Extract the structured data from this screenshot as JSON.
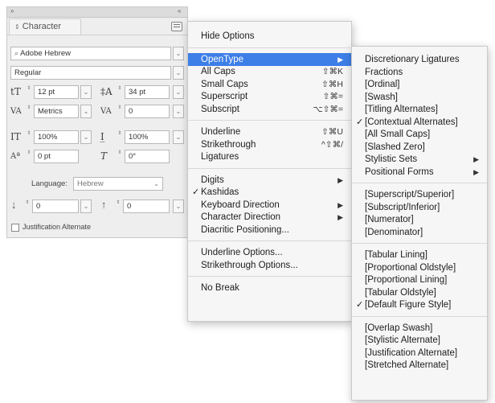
{
  "panel": {
    "topbar_left": "»",
    "topbar_right": "«",
    "title": "Character",
    "font_family": "Adobe Hebrew",
    "font_style": "Regular",
    "font_size": "12 pt",
    "leading": "34 pt",
    "kerning": "Metrics",
    "tracking": "0",
    "vertical_scale": "100%",
    "horizontal_scale": "100%",
    "baseline_shift": "0 pt",
    "skew": "0°",
    "language_label": "Language:",
    "language_value": "Hebrew",
    "space_before": "0",
    "space_after": "0",
    "justification_label": "Justification Alternate"
  },
  "menu_main": [
    {
      "label": "Hide Options"
    },
    {
      "sep": true
    },
    {
      "label": "OpenType",
      "submenu": true,
      "highlighted": true
    },
    {
      "label": "All Caps",
      "shortcut": "⇧⌘K"
    },
    {
      "label": "Small Caps",
      "shortcut": "⇧⌘H"
    },
    {
      "label": "Superscript",
      "shortcut": "⇧⌘="
    },
    {
      "label": "Subscript",
      "shortcut": "⌥⇧⌘="
    },
    {
      "sep": true
    },
    {
      "label": "Underline",
      "shortcut": "⇧⌘U"
    },
    {
      "label": "Strikethrough",
      "shortcut": "^⇧⌘/"
    },
    {
      "label": "Ligatures"
    },
    {
      "sep": true
    },
    {
      "label": "Digits",
      "submenu": true
    },
    {
      "label": "Kashidas",
      "checked": true
    },
    {
      "label": "Keyboard Direction",
      "submenu": true
    },
    {
      "label": "Character Direction",
      "submenu": true
    },
    {
      "label": "Diacritic Positioning..."
    },
    {
      "sep": true
    },
    {
      "label": "Underline Options..."
    },
    {
      "label": "Strikethrough Options..."
    },
    {
      "sep": true
    },
    {
      "label": "No Break"
    }
  ],
  "menu_opentype": [
    {
      "label": "Discretionary Ligatures"
    },
    {
      "label": "Fractions"
    },
    {
      "label": "[Ordinal]"
    },
    {
      "label": "[Swash]"
    },
    {
      "label": "[Titling Alternates]"
    },
    {
      "label": "[Contextual Alternates]",
      "checked": true
    },
    {
      "label": "[All Small Caps]"
    },
    {
      "label": "[Slashed Zero]"
    },
    {
      "label": "Stylistic Sets",
      "submenu": true
    },
    {
      "label": "Positional Forms",
      "submenu": true
    },
    {
      "sep": true
    },
    {
      "label": "[Superscript/Superior]"
    },
    {
      "label": "[Subscript/Inferior]"
    },
    {
      "label": "[Numerator]"
    },
    {
      "label": "[Denominator]"
    },
    {
      "sep": true
    },
    {
      "label": "[Tabular Lining]"
    },
    {
      "label": "[Proportional Oldstyle]"
    },
    {
      "label": "[Proportional Lining]"
    },
    {
      "label": "[Tabular Oldstyle]"
    },
    {
      "label": "[Default Figure Style]",
      "checked": true
    },
    {
      "sep": true
    },
    {
      "label": "[Overlap Swash]"
    },
    {
      "label": "[Stylistic Alternate]"
    },
    {
      "label": "[Justification Alternate]"
    },
    {
      "label": "[Stretched Alternate]"
    }
  ],
  "colors": {
    "highlight": "#3d7ee7"
  },
  "icons": {
    "check": "✓",
    "submenu_arrow": "▶",
    "dropdown": "⌄",
    "stepper": "⇕"
  }
}
